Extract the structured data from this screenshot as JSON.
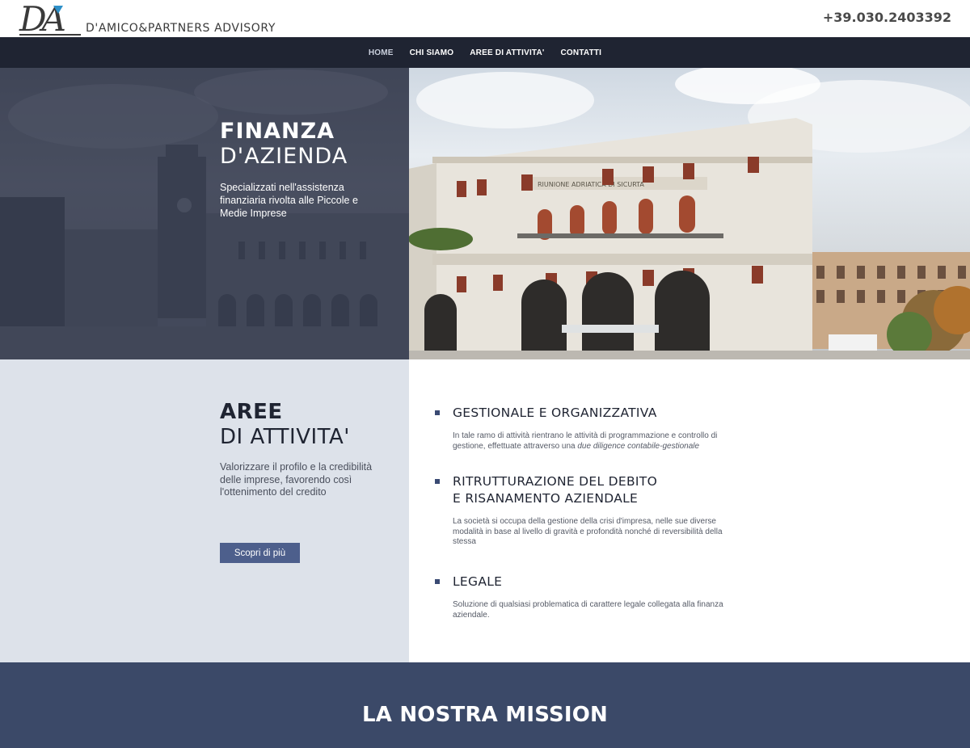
{
  "header": {
    "logo_mark": "DA",
    "logo_name": "D'AMICO&PARTNERS ADVISORY",
    "phone": "+39.030.2403392"
  },
  "nav": {
    "items": [
      {
        "label": "HOME",
        "active": true
      },
      {
        "label": "CHI SIAMO",
        "active": false
      },
      {
        "label": "AREE DI ATTIVITA'",
        "active": false
      },
      {
        "label": "CONTATTI",
        "active": false
      }
    ]
  },
  "hero": {
    "title_bold": "FINANZA",
    "title_light": "D'AZIENDA",
    "subtitle": "Specializzati nell'assistenza finanziaria rivolta alle Piccole e Medie Imprese",
    "building_inscription": "RIUNIONE ADRIATICA DI SICURTA"
  },
  "aree": {
    "title_bold": "AREE",
    "title_light": "DI ATTIVITA'",
    "text": "Valorizzare il profilo e la credibilità delle imprese, favorendo così l'ottenimento del credito",
    "button_label": "Scopri di più",
    "items": [
      {
        "title_line1": "GESTIONALE E ORGANIZZATIVA",
        "title_line2": "",
        "desc_plain": "In tale ramo di attività rientrano le attività di programmazione e controllo di gestione, effettuate attraverso una ",
        "desc_italic": "due diligence contabile-gestionale"
      },
      {
        "title_line1": "RITRUTTURAZIONE DEL DEBITO",
        "title_line2": "E RISANAMENTO AZIENDALE",
        "desc_plain": "La società si occupa della gestione della crisi d'impresa, nelle sue diverse modalità in base al livello di gravità e profondità nonché di reversibilità della stessa",
        "desc_italic": ""
      },
      {
        "title_line1": "LEGALE",
        "title_line2": "",
        "desc_plain": "Soluzione di qualsiasi problematica di carattere legale collegata alla finanza aziendale.",
        "desc_italic": ""
      }
    ]
  },
  "mission": {
    "title": "LA NOSTRA MISSION"
  },
  "colors": {
    "nav_bg": "#1f2432",
    "aree_left_bg": "#dde2ea",
    "button_bg": "#4d5f8c",
    "mission_bg": "#3b4968",
    "logo_accent": "#2e90c9"
  }
}
